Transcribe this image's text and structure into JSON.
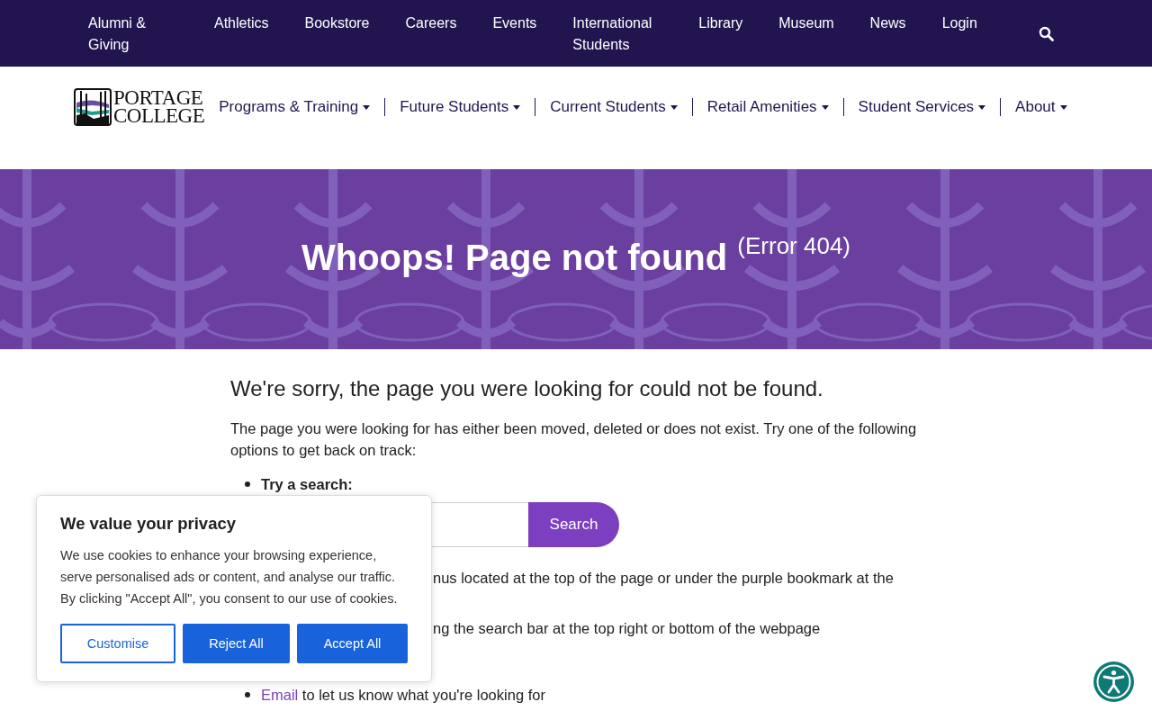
{
  "top_nav": {
    "links": [
      {
        "label": "Alumni & Giving"
      },
      {
        "label": "Athletics"
      },
      {
        "label": "Bookstore"
      },
      {
        "label": "Careers"
      },
      {
        "label": "Events"
      },
      {
        "label": "International Students"
      },
      {
        "label": "Library"
      },
      {
        "label": "Museum"
      },
      {
        "label": "News"
      },
      {
        "label": "Login"
      }
    ]
  },
  "logo": {
    "line1": "PORTAGE",
    "line2": "COLLEGE"
  },
  "main_nav": [
    {
      "label": "Programs & Training",
      "dropdown": true
    },
    {
      "label": "Future Students",
      "dropdown": true
    },
    {
      "label": "Current Students",
      "dropdown": true
    },
    {
      "label": "Retail Amenities",
      "dropdown": true
    },
    {
      "label": "Student Services",
      "dropdown": true
    },
    {
      "label": "About",
      "dropdown": true
    }
  ],
  "banner": {
    "title": "Whoops! Page not found",
    "note": "(Error 404)"
  },
  "content": {
    "heading": "We're sorry, the page you were looking for could not be found.",
    "intro": "The page you were looking for has either been moved, deleted or does not exist. Try one of the following options to get back on track:",
    "options": [
      {
        "kind": "search",
        "label": "Try a search:",
        "button": "Search"
      },
      {
        "kind": "fragment",
        "text": "nus located at the top of the page or under the purple bookmark at the"
      },
      {
        "kind": "fragment",
        "text": "ng the search bar at the top right or bottom of the webpage"
      },
      {
        "kind": "link",
        "link": "Email",
        "text": "to let us know what you're looking for"
      }
    ]
  },
  "cookie_banner": {
    "title": "We value your privacy",
    "text": "We use cookies to enhance your browsing experience, serve personalised ads or content, and analyse our traffic. By clicking \"Accept All\", you consent to our use of cookies.",
    "buttons": [
      {
        "label": "Customise",
        "kind": "outline"
      },
      {
        "label": "Reject All",
        "kind": "solid"
      },
      {
        "label": "Accept All",
        "kind": "solid"
      }
    ]
  }
}
